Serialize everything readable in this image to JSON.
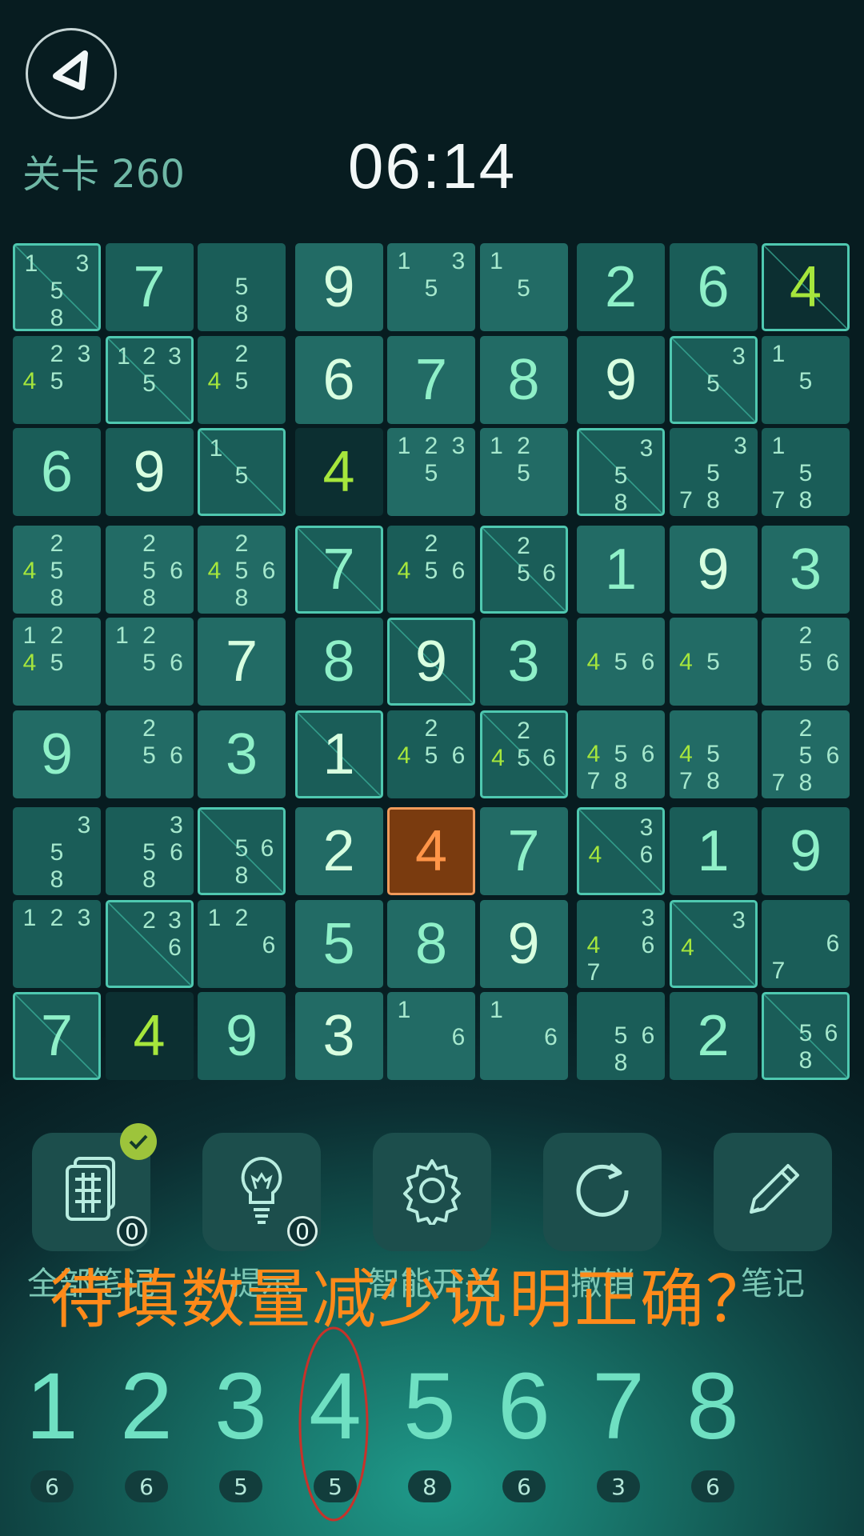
{
  "header": {
    "back_icon": "back-arrow-icon",
    "level_label": "关卡 260",
    "timer": "06:14"
  },
  "board": {
    "rows": [
      [
        {
          "n": [
            1,
            3,
            5,
            8
          ],
          "hl": [],
          "m": 1
        },
        {
          "v": "7"
        },
        {
          "n": [
            5,
            8
          ],
          "hl": []
        },
        {
          "v": "9",
          "g": 1
        },
        {
          "n": [
            1,
            3,
            5
          ],
          "hl": []
        },
        {
          "n": [
            1,
            5
          ],
          "hl": []
        },
        {
          "v": "2"
        },
        {
          "v": "6"
        },
        {
          "v": "4",
          "hl": 1,
          "d": 1,
          "m": 1
        }
      ],
      [
        {
          "n": [
            2,
            3,
            4,
            5
          ],
          "hl": [
            4
          ]
        },
        {
          "n": [
            1,
            2,
            3,
            5
          ],
          "hl": [],
          "m": 1
        },
        {
          "n": [
            2,
            4,
            5
          ],
          "hl": [
            4
          ]
        },
        {
          "v": "6",
          "g": 1
        },
        {
          "v": "7"
        },
        {
          "v": "8"
        },
        {
          "v": "9",
          "g": 1
        },
        {
          "n": [
            3,
            5
          ],
          "hl": [],
          "m": 1
        },
        {
          "n": [
            1,
            5
          ],
          "hl": []
        }
      ],
      [
        {
          "v": "6"
        },
        {
          "v": "9",
          "g": 1
        },
        {
          "n": [
            1,
            5
          ],
          "hl": [],
          "m": 1
        },
        {
          "v": "4",
          "hl": 1,
          "d": 1
        },
        {
          "n": [
            1,
            2,
            3,
            5
          ],
          "hl": []
        },
        {
          "n": [
            1,
            2,
            5
          ],
          "hl": []
        },
        {
          "n": [
            3,
            5,
            8
          ],
          "hl": [],
          "m": 1
        },
        {
          "n": [
            3,
            5,
            7,
            8
          ],
          "hl": []
        },
        {
          "n": [
            1,
            5,
            7,
            8
          ],
          "hl": []
        }
      ],
      [
        {
          "n": [
            2,
            4,
            5,
            8
          ],
          "hl": [
            4
          ]
        },
        {
          "n": [
            2,
            5,
            6,
            8
          ],
          "hl": []
        },
        {
          "n": [
            2,
            4,
            5,
            6,
            8
          ],
          "hl": [
            4
          ]
        },
        {
          "v": "7",
          "m": 1
        },
        {
          "n": [
            2,
            4,
            5,
            6
          ],
          "hl": [
            4
          ]
        },
        {
          "n": [
            2,
            5,
            6
          ],
          "hl": [],
          "m": 1
        },
        {
          "v": "1"
        },
        {
          "v": "9",
          "g": 1
        },
        {
          "v": "3"
        }
      ],
      [
        {
          "n": [
            1,
            2,
            4,
            5
          ],
          "hl": [
            4
          ]
        },
        {
          "n": [
            1,
            2,
            5,
            6
          ],
          "hl": []
        },
        {
          "v": "7",
          "g": 1
        },
        {
          "v": "8"
        },
        {
          "v": "9",
          "g": 1,
          "m": 1
        },
        {
          "v": "3"
        },
        {
          "n": [
            4,
            5,
            6
          ],
          "hl": [
            4
          ]
        },
        {
          "n": [
            4,
            5
          ],
          "hl": [
            4
          ]
        },
        {
          "n": [
            2,
            5,
            6
          ],
          "hl": []
        }
      ],
      [
        {
          "v": "9"
        },
        {
          "n": [
            2,
            5,
            6
          ],
          "hl": []
        },
        {
          "v": "3"
        },
        {
          "v": "1",
          "g": 1,
          "m": 1
        },
        {
          "n": [
            2,
            4,
            5,
            6
          ],
          "hl": [
            4
          ]
        },
        {
          "n": [
            2,
            4,
            5,
            6
          ],
          "hl": [
            4
          ],
          "m": 1
        },
        {
          "n": [
            4,
            5,
            6,
            7,
            8
          ],
          "hl": [
            4
          ]
        },
        {
          "n": [
            4,
            5,
            7,
            8
          ],
          "hl": [
            4
          ]
        },
        {
          "n": [
            2,
            5,
            6,
            7,
            8
          ],
          "hl": []
        }
      ],
      [
        {
          "n": [
            3,
            5,
            8
          ],
          "hl": []
        },
        {
          "n": [
            3,
            5,
            6,
            8
          ],
          "hl": []
        },
        {
          "n": [
            5,
            6,
            8
          ],
          "hl": [],
          "m": 1
        },
        {
          "v": "2",
          "g": 1
        },
        {
          "v": "4",
          "err": 1,
          "sel": 1
        },
        {
          "v": "7"
        },
        {
          "n": [
            3,
            4,
            6
          ],
          "hl": [
            4
          ],
          "m": 1
        },
        {
          "v": "1"
        },
        {
          "v": "9"
        }
      ],
      [
        {
          "n": [
            1,
            2,
            3
          ],
          "hl": []
        },
        {
          "n": [
            2,
            3,
            6
          ],
          "hl": [],
          "m": 1
        },
        {
          "n": [
            1,
            2,
            6
          ],
          "hl": []
        },
        {
          "v": "5"
        },
        {
          "v": "8"
        },
        {
          "v": "9",
          "g": 1
        },
        {
          "n": [
            3,
            4,
            6,
            7
          ],
          "hl": [
            4
          ]
        },
        {
          "n": [
            3,
            4
          ],
          "hl": [
            4
          ],
          "m": 1
        },
        {
          "n": [
            6,
            7
          ],
          "hl": []
        }
      ],
      [
        {
          "v": "7",
          "m": 1
        },
        {
          "v": "4",
          "hl": 1,
          "d": 1
        },
        {
          "v": "9"
        },
        {
          "v": "3",
          "g": 1
        },
        {
          "n": [
            1,
            6
          ],
          "hl": []
        },
        {
          "n": [
            1,
            6
          ],
          "hl": []
        },
        {
          "n": [
            5,
            6,
            8
          ],
          "hl": []
        },
        {
          "v": "2"
        },
        {
          "n": [
            5,
            6,
            8
          ],
          "hl": [],
          "m": 1
        }
      ]
    ]
  },
  "tools": [
    {
      "label": "全部笔记",
      "icon": "notes-stack-icon",
      "count": "0",
      "checked": true
    },
    {
      "label": "提示",
      "icon": "lightbulb-icon",
      "count": "0"
    },
    {
      "label": "智能开关",
      "icon": "gear-icon"
    },
    {
      "label": "撤销",
      "icon": "undo-icon"
    },
    {
      "label": "笔记",
      "icon": "pencil-icon"
    }
  ],
  "overlay_text": "待填数量减少说明正确？",
  "numpad": [
    {
      "digit": "1",
      "count": "6"
    },
    {
      "digit": "2",
      "count": "6"
    },
    {
      "digit": "3",
      "count": "5"
    },
    {
      "digit": "4",
      "count": "5"
    },
    {
      "digit": "5",
      "count": "8"
    },
    {
      "digit": "6",
      "count": "6"
    },
    {
      "digit": "7",
      "count": "3"
    },
    {
      "digit": "8",
      "count": "6"
    }
  ],
  "colors": {
    "accent_green": "#a6e63c",
    "error_orange": "#ff9548",
    "annotation_red": "#c8322a",
    "overlay_orange": "#ff8a1a"
  }
}
